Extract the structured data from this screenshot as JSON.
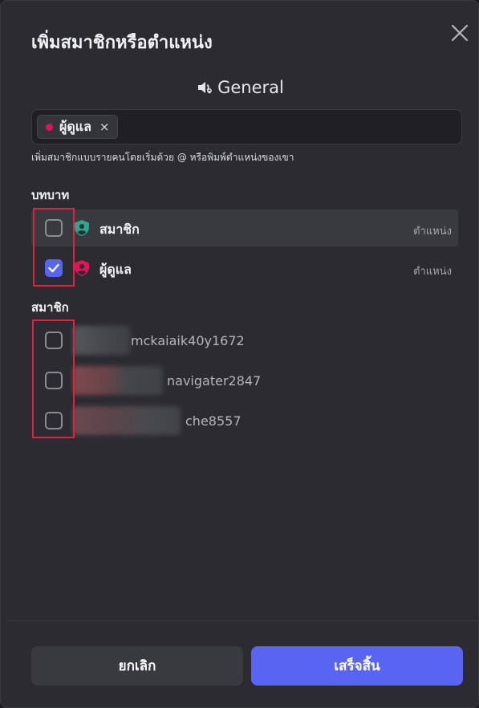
{
  "dialog": {
    "title": "เพิ่มสมาชิกหรือตำแหน่ง",
    "channel_name": "General",
    "selected_chip": {
      "label": "ผู้ดูแล",
      "remove_symbol": "×",
      "dot_color": "#e0135b"
    },
    "hint": "เพิ่มสมาชิกแบบรายคนโดยเริ่มด้วย @ หรือพิมพ์ตำแหน่งของเขา"
  },
  "roles_section": {
    "heading": "บทบาท",
    "items": [
      {
        "label": "สมาชิก",
        "tag": "ตำแหน่ง",
        "checked": false,
        "icon": "role-shield-icon",
        "color": "#2fa48e"
      },
      {
        "label": "ผู้ดูแล",
        "tag": "ตำแหน่ง",
        "checked": true,
        "icon": "role-shield-icon",
        "color": "#e0135b"
      }
    ]
  },
  "members_section": {
    "heading": "สมาชิก",
    "items": [
      {
        "name": "mckaiaik40y1672",
        "checked": false
      },
      {
        "name": "navigater2847",
        "checked": false
      },
      {
        "name": "che8557",
        "checked": false
      }
    ]
  },
  "footer": {
    "cancel_label": "ยกเลิก",
    "done_label": "เสร็จสิ้น"
  },
  "colors": {
    "accent": "#5865f2",
    "highlight_box": "#e0223f"
  }
}
